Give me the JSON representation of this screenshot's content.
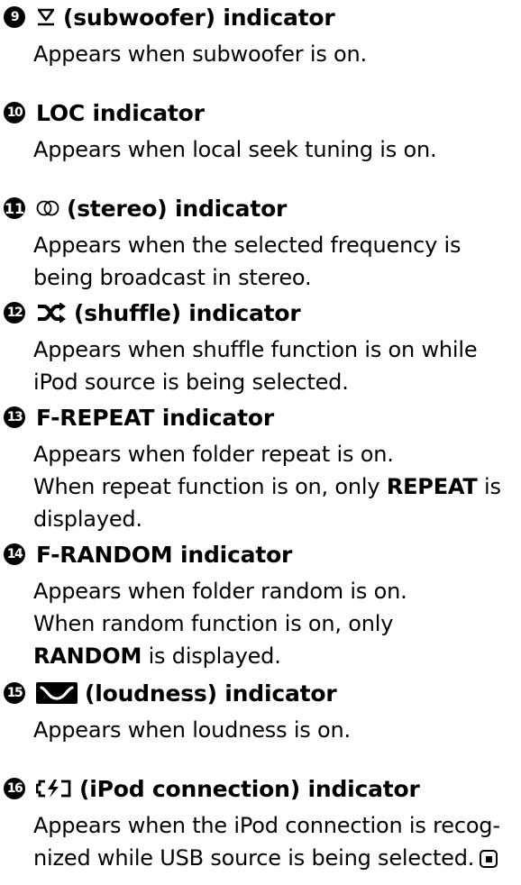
{
  "entries": [
    {
      "number": "9",
      "icon": "subwoofer-icon",
      "heading": "(subwoofer) indicator",
      "lines": [
        "Appears when subwoofer is on."
      ]
    },
    {
      "number": "10",
      "icon": "",
      "heading": "LOC indicator",
      "lines": [
        "Appears when local seek tuning is on."
      ]
    },
    {
      "number": "11",
      "icon": "stereo-icon",
      "heading": "(stereo) indicator",
      "lines": [
        "Appears when the selected frequency is",
        "being broadcast in stereo."
      ]
    },
    {
      "number": "12",
      "icon": "shuffle-icon",
      "heading": "(shuffle) indicator",
      "lines": [
        "Appears when shuffle function is on while",
        "iPod source is being selected."
      ]
    },
    {
      "number": "13",
      "icon": "",
      "heading": "F-REPEAT indicator",
      "lines": [
        "Appears when folder repeat is on."
      ],
      "line2_prefix": "When repeat function is on, only ",
      "line2_bold": "REPEAT",
      "line2_suffix": " is",
      "line3": "displayed."
    },
    {
      "number": "14",
      "icon": "",
      "heading": "F-RANDOM indicator",
      "lines": [
        "Appears when folder random is on.",
        "When random function is on, only"
      ],
      "line3_bold": "RANDOM",
      "line3_suffix": " is displayed."
    },
    {
      "number": "15",
      "icon": "loudness-icon",
      "heading": "(loudness) indicator",
      "lines": [
        "Appears when loudness is on."
      ]
    },
    {
      "number": "16",
      "icon": "ipod-connection-icon",
      "heading": "(iPod connection) indicator",
      "lines": [
        "Appears when the iPod connection is recog-",
        "nized while USB source is being selected."
      ],
      "end_mark": "end-of-section-icon"
    }
  ]
}
